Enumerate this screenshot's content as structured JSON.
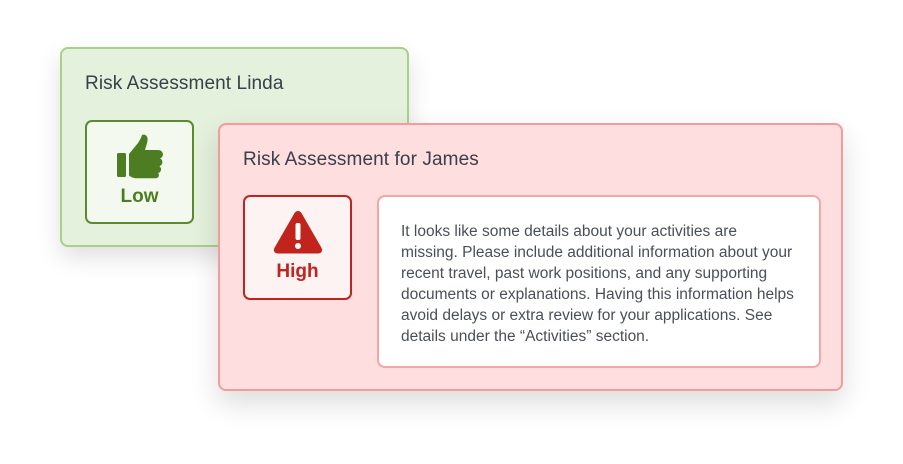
{
  "cards": {
    "linda": {
      "title": "Risk Assessment Linda",
      "level_label": "Low",
      "icon": "thumbs-up-icon",
      "color": "#4c7d23",
      "background": "#e4f1dc"
    },
    "james": {
      "title": "Risk Assessment for James",
      "level_label": "High",
      "icon": "warning-triangle-icon",
      "color": "#c1231d",
      "background": "#fedede",
      "message": "It looks like some details about your activities are missing. Please include additional information about your recent travel, past work positions, and any supporting documents or explanations. Having this information helps avoid delays or extra review for your applications. See details under the “Activities” section."
    }
  }
}
